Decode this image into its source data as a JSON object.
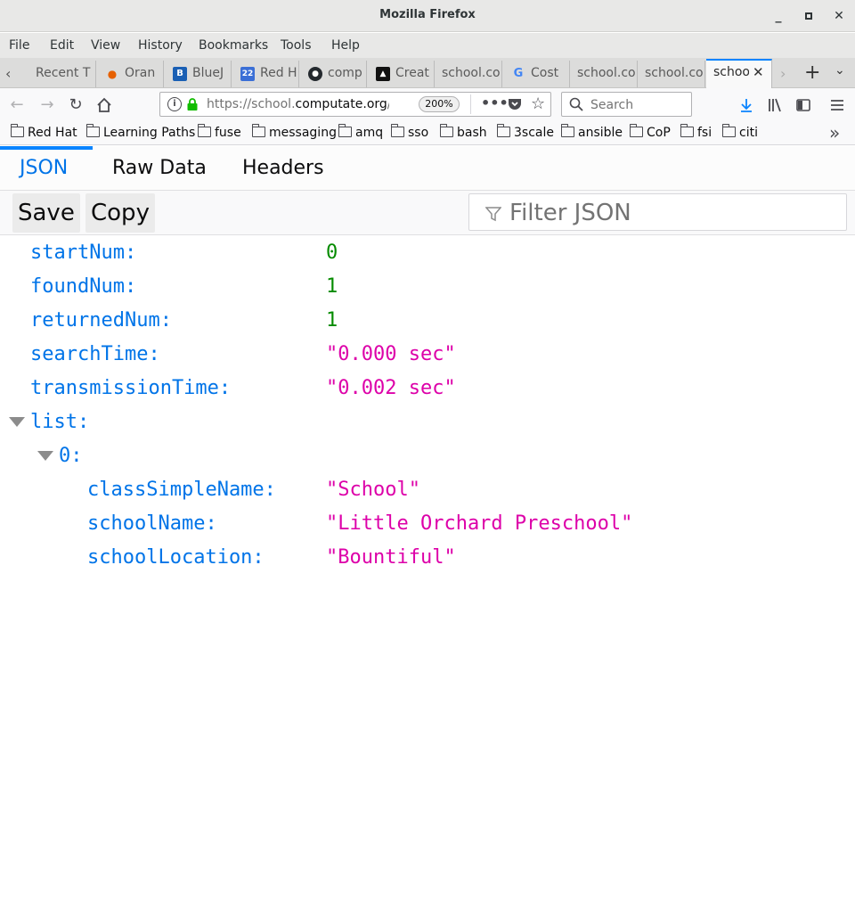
{
  "window": {
    "title": "Mozilla Firefox"
  },
  "menu": [
    "File",
    "Edit",
    "View",
    "History",
    "Bookmarks",
    "Tools",
    "Help"
  ],
  "tabs": [
    {
      "label": "Recent T",
      "icon": "blank-page-icon"
    },
    {
      "label": "Oran",
      "icon": "orange-icon"
    },
    {
      "label": "BlueJ",
      "icon": "bluejeans-icon"
    },
    {
      "label": "Red H",
      "icon": "calendar-icon"
    },
    {
      "label": "comp",
      "icon": "github-icon"
    },
    {
      "label": "Creat",
      "icon": "bookmark-app-icon"
    },
    {
      "label": "school.co",
      "icon": ""
    },
    {
      "label": "Cost",
      "icon": "google-icon"
    },
    {
      "label": "school.co",
      "icon": ""
    },
    {
      "label": "school.co",
      "icon": ""
    },
    {
      "label": "schoo",
      "icon": "",
      "selected": true
    }
  ],
  "nav": {
    "url_prefix": "https://school.",
    "url_domain": "computate.org",
    "url_suffix": "/a",
    "zoom": "200%",
    "search_placeholder": "Search"
  },
  "bookmarks": [
    "Red Hat",
    "Learning Paths",
    "fuse",
    "messaging",
    "amq",
    "sso",
    "bash",
    "3scale",
    "ansible",
    "CoP",
    "fsi",
    "citi"
  ],
  "viewer": {
    "tabs": [
      "JSON",
      "Raw Data",
      "Headers"
    ],
    "save_label": "Save",
    "copy_label": "Copy",
    "filter_placeholder": "Filter JSON"
  },
  "json": {
    "startNum": {
      "key": "startNum:",
      "value": "0"
    },
    "foundNum": {
      "key": "foundNum:",
      "value": "1"
    },
    "returnedNum": {
      "key": "returnedNum:",
      "value": "1"
    },
    "searchTime": {
      "key": "searchTime:",
      "value": "\"0.000 sec\""
    },
    "transmissionTime": {
      "key": "transmissionTime:",
      "value": "\"0.002 sec\""
    },
    "list": {
      "key": "list:"
    },
    "item0": {
      "key": "0:"
    },
    "classSimpleName": {
      "key": "classSimpleName:",
      "value": "\"School\""
    },
    "schoolName": {
      "key": "schoolName:",
      "value": "\"Little Orchard Preschool\""
    },
    "schoolLocation": {
      "key": "schoolLocation:",
      "value": "\"Bountiful\""
    }
  },
  "colors": {
    "accent": "#0a84ff",
    "json_key": "#0074e8",
    "json_number": "#058b00",
    "json_string": "#dd00a9"
  }
}
